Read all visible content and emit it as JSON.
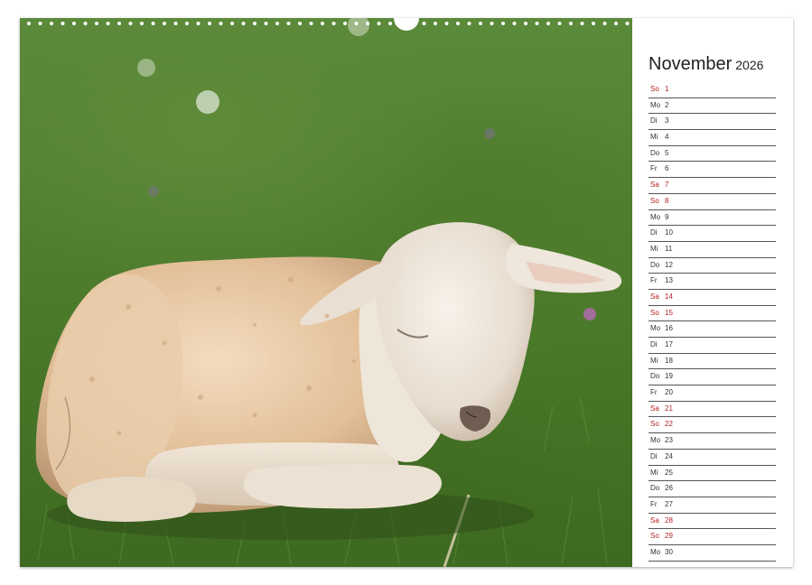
{
  "calendar": {
    "month": "November",
    "year": "2026",
    "days": [
      {
        "wd": "So",
        "d": "1",
        "weekend": true
      },
      {
        "wd": "Mo",
        "d": "2",
        "weekend": false
      },
      {
        "wd": "Di",
        "d": "3",
        "weekend": false
      },
      {
        "wd": "Mi",
        "d": "4",
        "weekend": false
      },
      {
        "wd": "Do",
        "d": "5",
        "weekend": false
      },
      {
        "wd": "Fr",
        "d": "6",
        "weekend": false
      },
      {
        "wd": "Sa",
        "d": "7",
        "weekend": true
      },
      {
        "wd": "So",
        "d": "8",
        "weekend": true
      },
      {
        "wd": "Mo",
        "d": "9",
        "weekend": false
      },
      {
        "wd": "Di",
        "d": "10",
        "weekend": false
      },
      {
        "wd": "Mi",
        "d": "11",
        "weekend": false
      },
      {
        "wd": "Do",
        "d": "12",
        "weekend": false
      },
      {
        "wd": "Fr",
        "d": "13",
        "weekend": false
      },
      {
        "wd": "Sa",
        "d": "14",
        "weekend": true
      },
      {
        "wd": "So",
        "d": "15",
        "weekend": true
      },
      {
        "wd": "Mo",
        "d": "16",
        "weekend": false
      },
      {
        "wd": "Di",
        "d": "17",
        "weekend": false
      },
      {
        "wd": "Mi",
        "d": "18",
        "weekend": false
      },
      {
        "wd": "Do",
        "d": "19",
        "weekend": false
      },
      {
        "wd": "Fr",
        "d": "20",
        "weekend": false
      },
      {
        "wd": "Sa",
        "d": "21",
        "weekend": true
      },
      {
        "wd": "So",
        "d": "22",
        "weekend": true
      },
      {
        "wd": "Mo",
        "d": "23",
        "weekend": false
      },
      {
        "wd": "Di",
        "d": "24",
        "weekend": false
      },
      {
        "wd": "Mi",
        "d": "25",
        "weekend": false
      },
      {
        "wd": "Do",
        "d": "26",
        "weekend": false
      },
      {
        "wd": "Fr",
        "d": "27",
        "weekend": false
      },
      {
        "wd": "Sa",
        "d": "28",
        "weekend": true
      },
      {
        "wd": "So",
        "d": "29",
        "weekend": true
      },
      {
        "wd": "Mo",
        "d": "30",
        "weekend": false
      }
    ]
  },
  "colors": {
    "weekend": "#b22222",
    "weekday": "#333333",
    "grass": "#4e7d2d"
  },
  "photo": {
    "subject_icon": "lamb-photo"
  }
}
